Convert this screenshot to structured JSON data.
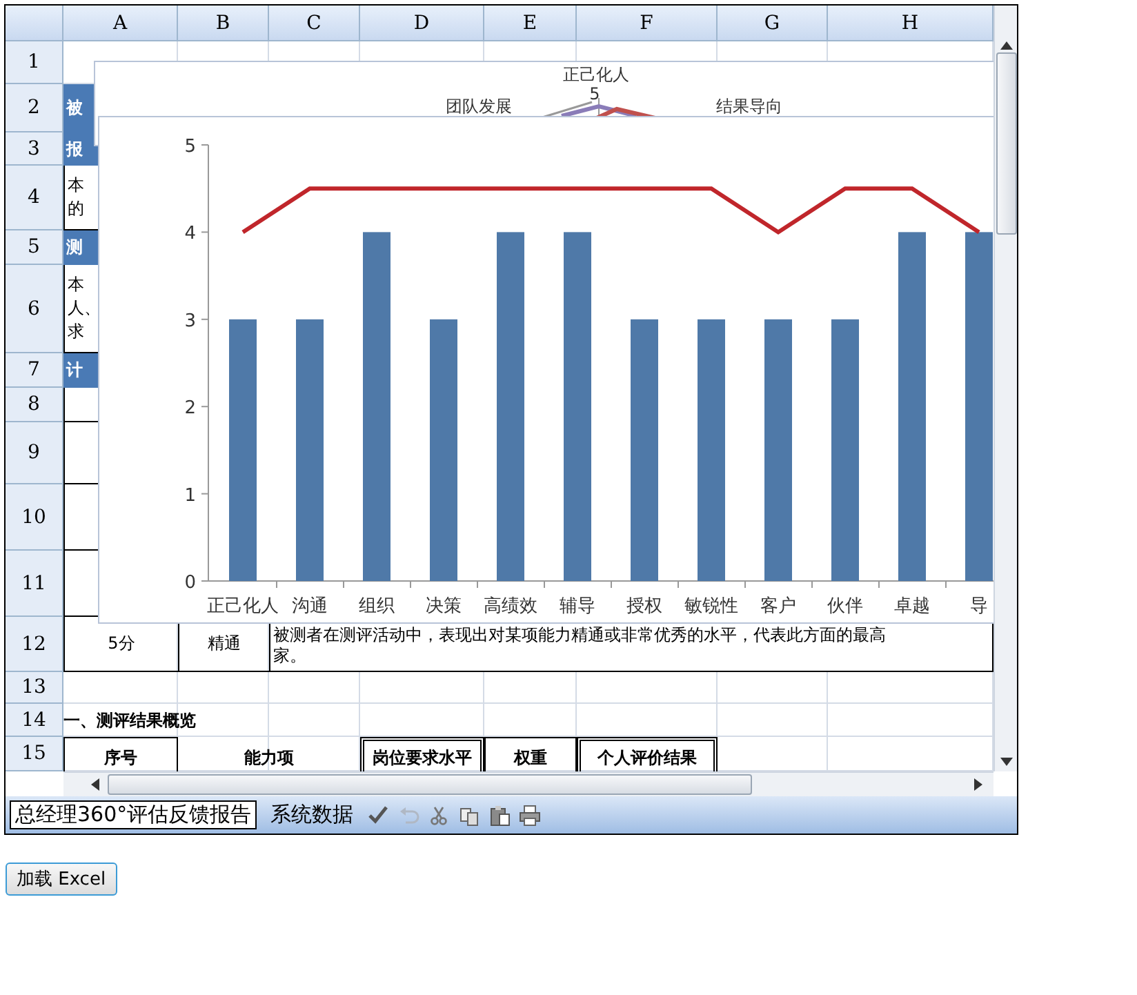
{
  "columns": [
    "A",
    "B",
    "C",
    "D",
    "E",
    "F",
    "G",
    "H"
  ],
  "rows": [
    {
      "number": "1",
      "kind": "blank"
    },
    {
      "number": "2",
      "kind": "section",
      "text": "被"
    },
    {
      "number": "3",
      "kind": "section",
      "text": "报"
    },
    {
      "number": "4",
      "kind": "note",
      "lines": [
        "本",
        "的"
      ]
    },
    {
      "number": "5",
      "kind": "section",
      "text": "测"
    },
    {
      "number": "6",
      "kind": "note",
      "lines": [
        "本",
        "人、",
        "求"
      ]
    },
    {
      "number": "7",
      "kind": "section",
      "text": "计"
    },
    {
      "number": "8",
      "kind": "level"
    },
    {
      "number": "9",
      "kind": "level"
    },
    {
      "number": "10",
      "kind": "level"
    },
    {
      "number": "11",
      "kind": "level"
    },
    {
      "number": "12",
      "kind": "level",
      "score": "5分",
      "grade": "精通",
      "lines": [
        "被测者在测评活动中，表现出对某项能力精通或非常优秀的水平，代表此方面的最高",
        "家。"
      ]
    },
    {
      "number": "13",
      "kind": "blank"
    },
    {
      "number": "14",
      "kind": "heading",
      "text": "一、测评结果概览"
    },
    {
      "number": "15",
      "kind": "table_head",
      "cells": [
        "序号",
        "能力项",
        "岗位要求水平",
        "权重",
        "个人评价结果"
      ]
    }
  ],
  "radar_chart": {
    "labels": [
      "正己化人",
      "团队发展",
      "结果导向"
    ],
    "tick": "5"
  },
  "bar_chart": {
    "chart_data": {
      "type": "bar",
      "categories": [
        "正己化人",
        "沟通",
        "组织",
        "决策",
        "高绩效",
        "辅导",
        "授权",
        "敏锐性",
        "客户",
        "伙伴",
        "卓越",
        "导"
      ],
      "ylim": [
        0,
        5
      ],
      "yticks": [
        0,
        1,
        2,
        3,
        4,
        5
      ],
      "series": [
        {
          "type": "bar",
          "color": "#4f79a8",
          "values": [
            3,
            3,
            4,
            3,
            4,
            4,
            3,
            3,
            3,
            3,
            4,
            4
          ]
        },
        {
          "type": "line",
          "color": "#c0262b",
          "values": [
            4,
            4.5,
            4.5,
            4.5,
            4.5,
            4.5,
            4.5,
            4.5,
            4,
            4.5,
            4.5,
            4
          ]
        }
      ]
    }
  },
  "sheet_tabs": [
    {
      "label": "总经理360°评估反馈报告",
      "selected": true
    },
    {
      "label": "系统数据",
      "selected": false
    }
  ],
  "load_button": "加载 Excel"
}
